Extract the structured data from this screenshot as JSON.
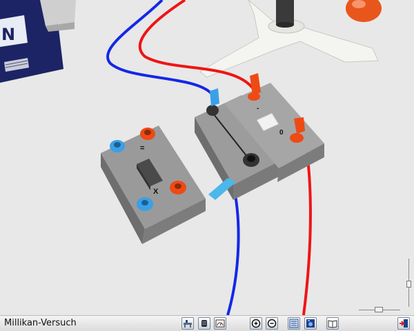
{
  "app": {
    "title": "Millikan-Versuch"
  },
  "scene": {
    "left_switch_mark_top": "=",
    "left_switch_mark_bottom": "X",
    "right_switch_mark_top": "-",
    "right_switch_mark_bottom": "0"
  },
  "toolbar": {
    "buttons": [
      {
        "icon": "workbench-icon"
      },
      {
        "icon": "cylinder-icon"
      },
      {
        "icon": "meter-icon"
      },
      {
        "icon": "zoom-in-icon"
      },
      {
        "icon": "zoom-out-icon"
      },
      {
        "icon": "panel-icon"
      },
      {
        "icon": "camera-icon"
      },
      {
        "icon": "book-icon"
      },
      {
        "icon": "exit-icon"
      }
    ]
  },
  "colors": {
    "cable_blue": "#1428e6",
    "cable_red": "#f01414",
    "terminal_blue": "#3aa0e8",
    "terminal_orange": "#ee4a14",
    "device_gray": "#8a8a8a"
  }
}
